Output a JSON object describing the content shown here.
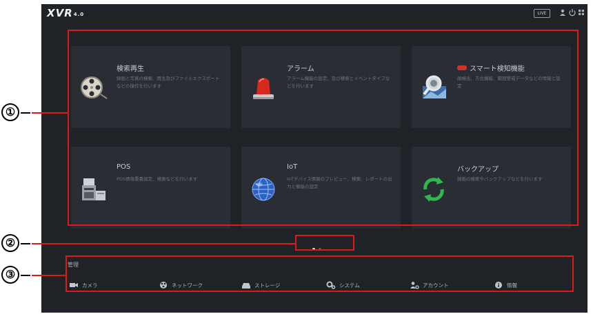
{
  "logo": {
    "text": "XVR",
    "version": "4.0"
  },
  "topbar": {
    "live_label": "LIVE",
    "icons": [
      "user-icon",
      "shutdown-icon",
      "menu-grid-icon"
    ]
  },
  "cards": [
    {
      "title": "検索再生",
      "desc": "録画と写真の検索、再生及びファイルエクスポートなどの操作を行います",
      "icon": "film-reel-icon",
      "badge": false
    },
    {
      "title": "アラーム",
      "desc": "アラーム機能の設定、及び検索とイベントタイプなどを行います",
      "icon": "alarm-light-icon",
      "badge": false
    },
    {
      "title": "スマート検知機能",
      "desc": "顔検出、方位機能、範囲警戒データなどの情報と設定",
      "icon": "smart-search-icon",
      "badge": true
    },
    {
      "title": "POS",
      "desc": "POS情報重畳設定、検索などを行います",
      "icon": "pos-terminal-icon",
      "badge": false
    },
    {
      "title": "IoT",
      "desc": "IoTデバイス情報のプレビュー、検索、レポートの出力と機能の設定",
      "icon": "globe-icon",
      "badge": false
    },
    {
      "title": "バックアップ",
      "desc": "録画の検索やバックアップなどを行います",
      "icon": "refresh-icon",
      "badge": false
    }
  ],
  "pagination": {
    "current": 1,
    "total": 2
  },
  "management": {
    "label": "管理",
    "items": [
      {
        "label": "カメラ",
        "icon": "camera-icon"
      },
      {
        "label": "ネットワーク",
        "icon": "network-icon"
      },
      {
        "label": "ストレージ",
        "icon": "storage-icon"
      },
      {
        "label": "システム",
        "icon": "system-gear-icon"
      },
      {
        "label": "アカウント",
        "icon": "account-icon"
      },
      {
        "label": "情報",
        "icon": "info-icon"
      }
    ]
  },
  "annotations": [
    "①",
    "②",
    "③"
  ],
  "colors": {
    "background": "#1f2227",
    "card": "#2a2d33",
    "annotation": "#e01818"
  }
}
